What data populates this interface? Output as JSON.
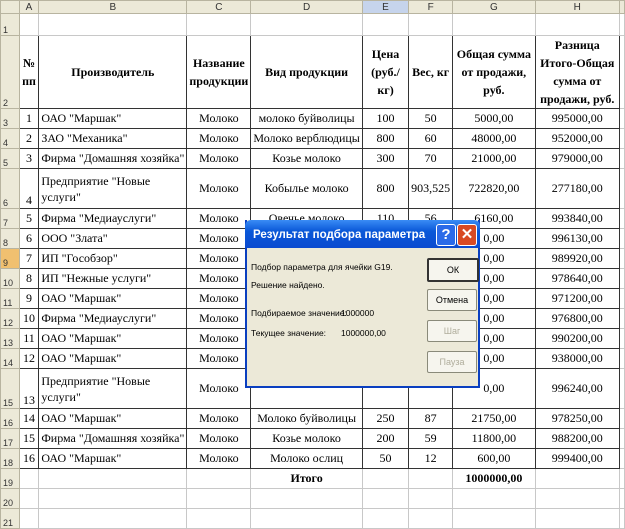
{
  "columns": [
    "A",
    "B",
    "C",
    "D",
    "E",
    "F",
    "G",
    "H"
  ],
  "headers": {
    "num": "№ пп",
    "producer": "Производитель",
    "name": "Название продукции",
    "type": "Вид продукции",
    "price": "Цена (руб./кг)",
    "weight": "Вес, кг",
    "total": "Общая сумма от продажи, руб.",
    "diff": "Разница Итого-Общая сумма от продажи, руб."
  },
  "rows": [
    {
      "r": "3",
      "n": "1",
      "p": "ОАО \"Маршак\"",
      "c": "Молоко",
      "d": "молоко буйволицы",
      "e": "100",
      "f": "50",
      "g": "5000,00",
      "h": "995000,00"
    },
    {
      "r": "4",
      "n": "2",
      "p": "ЗАО \"Механика\"",
      "c": "Молоко",
      "d": "Молоко верблюдицы",
      "e": "800",
      "f": "60",
      "g": "48000,00",
      "h": "952000,00"
    },
    {
      "r": "5",
      "n": "3",
      "p": "Фирма \"Домашняя хозяйка\"",
      "c": "Молоко",
      "d": "Козье молоко",
      "e": "300",
      "f": "70",
      "g": "21000,00",
      "h": "979000,00"
    },
    {
      "r": "6",
      "n": "4",
      "p": "Предприятие \"Новые услуги\"",
      "c": "Молоко",
      "d": "Кобылье молоко",
      "e": "800",
      "f": "903,525",
      "g": "722820,00",
      "h": "277180,00"
    },
    {
      "r": "7",
      "n": "5",
      "p": "Фирма \"Медиауслуги\"",
      "c": "Молоко",
      "d": "Овечье молоко",
      "e": "110",
      "f": "56",
      "g": "6160,00",
      "h": "993840,00"
    },
    {
      "r": "8",
      "n": "6",
      "p": "ООО \"Злата\"",
      "c": "Молоко",
      "d": "",
      "e": "",
      "f": "",
      "g": "0,00",
      "h": "996130,00"
    },
    {
      "r": "9",
      "n": "7",
      "p": "ИП \"Гособзор\"",
      "c": "Молоко",
      "d": "",
      "e": "",
      "f": "",
      "g": "0,00",
      "h": "989920,00"
    },
    {
      "r": "10",
      "n": "8",
      "p": "ИП \"Нежные услуги\"",
      "c": "Молоко",
      "d": "",
      "e": "",
      "f": "",
      "g": "0,00",
      "h": "978640,00"
    },
    {
      "r": "11",
      "n": "9",
      "p": "ОАО \"Маршак\"",
      "c": "Молоко",
      "d": "",
      "e": "",
      "f": "",
      "g": "0,00",
      "h": "971200,00"
    },
    {
      "r": "12",
      "n": "10",
      "p": "Фирма \"Медиауслуги\"",
      "c": "Молоко",
      "d": "",
      "e": "",
      "f": "",
      "g": "0,00",
      "h": "976800,00"
    },
    {
      "r": "13",
      "n": "11",
      "p": "ОАО \"Маршак\"",
      "c": "Молоко",
      "d": "",
      "e": "",
      "f": "",
      "g": "0,00",
      "h": "990200,00"
    },
    {
      "r": "14",
      "n": "12",
      "p": "ОАО \"Маршак\"",
      "c": "Молоко",
      "d": "",
      "e": "",
      "f": "",
      "g": "0,00",
      "h": "938000,00"
    },
    {
      "r": "15",
      "n": "13",
      "p": "Предприятие \"Новые услуги\"",
      "c": "Молоко",
      "d": "",
      "e": "",
      "f": "",
      "g": "0,00",
      "h": "996240,00"
    },
    {
      "r": "16",
      "n": "14",
      "p": "ОАО \"Маршак\"",
      "c": "Молоко",
      "d": "Молоко буйволицы",
      "e": "250",
      "f": "87",
      "g": "21750,00",
      "h": "978250,00"
    },
    {
      "r": "17",
      "n": "15",
      "p": "Фирма \"Домашняя хозяйка\"",
      "c": "Молоко",
      "d": "Козье молоко",
      "e": "200",
      "f": "59",
      "g": "11800,00",
      "h": "988200,00"
    },
    {
      "r": "18",
      "n": "16",
      "p": "ОАО \"Маршак\"",
      "c": "Молоко",
      "d": "Молоко ослиц",
      "e": "50",
      "f": "12",
      "g": "600,00",
      "h": "999400,00"
    }
  ],
  "total": {
    "label": "Итого",
    "value": "1000000,00"
  },
  "row_numbers": {
    "r1": "1",
    "r2": "2",
    "r19": "19",
    "r20": "20",
    "r21": "21"
  },
  "dialog": {
    "title": "Результат подбора параметра",
    "line1": "Подбор параметра для ячейки G19.",
    "line2": "Решение найдено.",
    "target_label": "Подбираемое значение:",
    "target_value": "1000000",
    "current_label": "Текущее значение:",
    "current_value": "1000000,00",
    "ok": "ОК",
    "cancel": "Отмена",
    "step": "Шаг",
    "pause": "Пауза",
    "help": "?",
    "close": "✕"
  }
}
